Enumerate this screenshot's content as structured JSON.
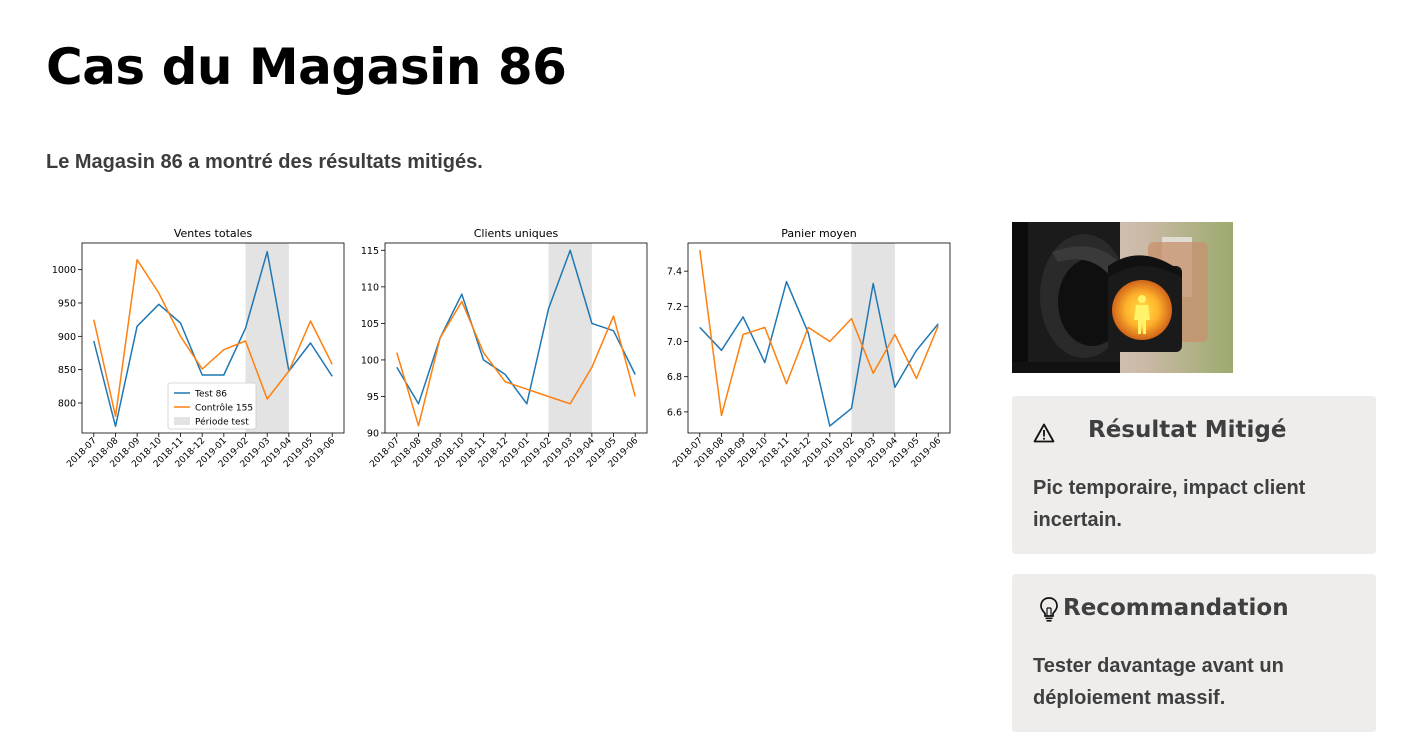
{
  "page": {
    "title": "Cas du Magasin 86",
    "subtitle": "Le Magasin 86 a montré des résultats mitigés."
  },
  "cards": {
    "result": {
      "icon": "warning-icon",
      "title": "Résultat Mitigé",
      "body": "Pic temporaire, impact client incertain."
    },
    "recommendation": {
      "icon": "lightbulb-icon",
      "title": "Recommandation",
      "body": "Tester davantage avant un déploiement massif."
    }
  },
  "photo": {
    "icon": "traffic-light-photo"
  },
  "colors": {
    "test": "#1f77b4",
    "control": "#ff7f0e",
    "period": "#e3e3e3",
    "card_bg": "#efedeb"
  },
  "chart_data": [
    {
      "type": "line",
      "title": "Ventes totales",
      "x": [
        "2018-07",
        "2018-08",
        "2018-09",
        "2018-10",
        "2018-11",
        "2018-12",
        "2019-01",
        "2019-02",
        "2019-03",
        "2019-04",
        "2019-05",
        "2019-06"
      ],
      "series": [
        {
          "name": "Test 86",
          "values": [
            893,
            765,
            915,
            948,
            920,
            842,
            842,
            912,
            1027,
            848,
            890,
            840
          ]
        },
        {
          "name": "Contrôle 155",
          "values": [
            925,
            780,
            1015,
            965,
            900,
            851,
            880,
            893,
            806,
            848,
            923,
            858
          ]
        }
      ],
      "shaded": {
        "label": "Période test",
        "from": "2019-02",
        "to": "2019-04"
      },
      "ylim": [
        755,
        1040
      ],
      "yticks": [
        800,
        850,
        900,
        950,
        1000
      ],
      "legend": "lower-center"
    },
    {
      "type": "line",
      "title": "Clients uniques",
      "x": [
        "2018-07",
        "2018-08",
        "2018-09",
        "2018-10",
        "2018-11",
        "2018-12",
        "2019-01",
        "2019-02",
        "2019-03",
        "2019-04",
        "2019-05",
        "2019-06"
      ],
      "series": [
        {
          "name": "Test 86",
          "values": [
            99,
            94,
            103,
            109,
            100,
            98,
            94,
            107,
            115,
            105,
            104,
            98
          ]
        },
        {
          "name": "Contrôle 155",
          "values": [
            101,
            91,
            103,
            108,
            101,
            97,
            96,
            95,
            94,
            99,
            106,
            95
          ]
        }
      ],
      "shaded": {
        "label": "Période test",
        "from": "2019-02",
        "to": "2019-04"
      },
      "ylim": [
        90,
        116
      ],
      "yticks": [
        90,
        95,
        100,
        105,
        110,
        115
      ]
    },
    {
      "type": "line",
      "title": "Panier moyen",
      "x": [
        "2018-07",
        "2018-08",
        "2018-09",
        "2018-10",
        "2018-11",
        "2018-12",
        "2019-01",
        "2019-02",
        "2019-03",
        "2019-04",
        "2019-05",
        "2019-06"
      ],
      "series": [
        {
          "name": "Test 86",
          "values": [
            7.08,
            6.95,
            7.14,
            6.88,
            7.34,
            7.05,
            6.52,
            6.62,
            7.33,
            6.74,
            6.95,
            7.1
          ]
        },
        {
          "name": "Contrôle 155",
          "values": [
            7.52,
            6.58,
            7.04,
            7.08,
            6.76,
            7.08,
            7.0,
            7.13,
            6.82,
            7.04,
            6.79,
            7.09
          ]
        }
      ],
      "shaded": {
        "label": "Période test",
        "from": "2019-02",
        "to": "2019-04"
      },
      "ylim": [
        6.48,
        7.56
      ],
      "yticks": [
        6.6,
        6.8,
        7.0,
        7.2,
        7.4
      ]
    }
  ]
}
